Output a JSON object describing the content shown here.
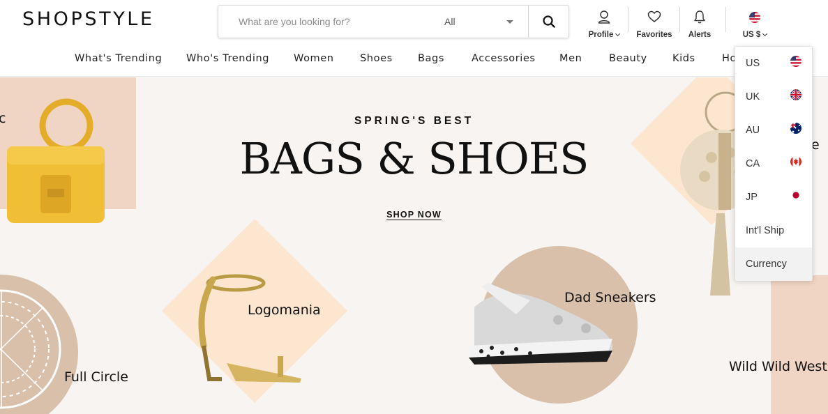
{
  "header": {
    "logo": "SHOPSTYLE",
    "search": {
      "placeholder": "What are you looking for?",
      "category_value": "All"
    },
    "profile_label": "Profile",
    "favorites_label": "Favorites",
    "alerts_label": "Alerts",
    "locale_label": "US $"
  },
  "nav": {
    "items": [
      "What's Trending",
      "Who's Trending",
      "Women",
      "Shoes",
      "Bags",
      "Accessories",
      "Men",
      "Beauty",
      "Kids",
      "Ho"
    ]
  },
  "hero": {
    "kicker": "SPRING'S BEST",
    "headline": "BAGS & SHOES",
    "cta": "SHOP NOW",
    "labels": {
      "left_partial": "c",
      "right_partial": "e",
      "logomania": "Logomania",
      "dad_sneakers": "Dad Sneakers",
      "full_circle": "Full Circle",
      "wild_west": "Wild Wild West"
    }
  },
  "locale_dropdown": {
    "items": [
      {
        "code": "US",
        "flag": "us-flag-icon"
      },
      {
        "code": "UK",
        "flag": "uk-flag-icon"
      },
      {
        "code": "AU",
        "flag": "au-flag-icon"
      },
      {
        "code": "CA",
        "flag": "ca-flag-icon"
      },
      {
        "code": "JP",
        "flag": "jp-flag-icon"
      },
      {
        "code": "Int'l Ship"
      },
      {
        "code": "Currency"
      }
    ],
    "highlighted": "Currency"
  },
  "colors": {
    "hero_bg": "#f8f4f1",
    "blush": "#f0d4c4",
    "taupe": "#d8c0aa",
    "cream": "#fde6cf"
  }
}
